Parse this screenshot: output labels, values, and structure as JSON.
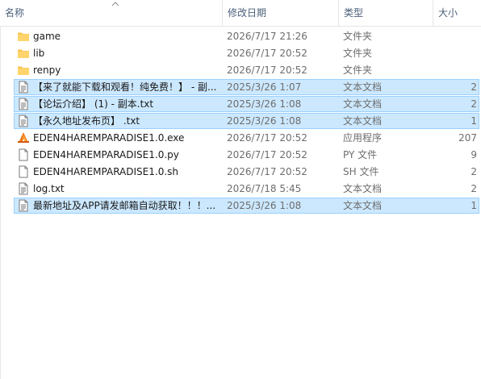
{
  "columns": {
    "name": "名称",
    "date": "修改日期",
    "type": "类型",
    "size": "大小"
  },
  "rows": [
    {
      "name": "game",
      "date": "2026/7/17 21:26",
      "type": "文件夹",
      "size": "",
      "icon": "folder-icon",
      "selected": false
    },
    {
      "name": "lib",
      "date": "2026/7/17 20:52",
      "type": "文件夹",
      "size": "",
      "icon": "folder-icon",
      "selected": false
    },
    {
      "name": "renpy",
      "date": "2026/7/17 20:52",
      "type": "文件夹",
      "size": "",
      "icon": "folder-icon",
      "selected": false
    },
    {
      "name": "【来了就能下载和观看！纯免费！】 - 副...",
      "date": "2025/3/26 1:07",
      "type": "文本文档",
      "size": "2",
      "icon": "text-file-icon",
      "selected": true
    },
    {
      "name": "【论坛介绍】 (1) - 副本.txt",
      "date": "2025/3/26 1:08",
      "type": "文本文档",
      "size": "2",
      "icon": "text-file-icon",
      "selected": true
    },
    {
      "name": "【永久地址发布页】 .txt",
      "date": "2025/3/26 1:08",
      "type": "文本文档",
      "size": "1",
      "icon": "text-file-icon",
      "selected": true
    },
    {
      "name": "EDEN4HAREMPARADISE1.0.exe",
      "date": "2026/7/17 20:52",
      "type": "应用程序",
      "size": "207",
      "icon": "renpy-app-icon",
      "selected": false
    },
    {
      "name": "EDEN4HAREMPARADISE1.0.py",
      "date": "2026/7/17 20:52",
      "type": "PY 文件",
      "size": "9",
      "icon": "blank-file-icon",
      "selected": false
    },
    {
      "name": "EDEN4HAREMPARADISE1.0.sh",
      "date": "2026/7/17 20:52",
      "type": "SH 文件",
      "size": "2",
      "icon": "blank-file-icon",
      "selected": false
    },
    {
      "name": "log.txt",
      "date": "2026/7/18 5:45",
      "type": "文本文档",
      "size": "2",
      "icon": "text-file-icon",
      "selected": false
    },
    {
      "name": "最新地址及APP请发邮箱自动获取！！！...",
      "date": "2025/3/26 1:08",
      "type": "文本文档",
      "size": "1",
      "icon": "text-file-icon",
      "selected": true
    }
  ],
  "colors": {
    "folder": "#f8c44f",
    "selection_fill": "#cce8ff",
    "selection_border": "#99d1ff",
    "header_text": "#4c607a"
  }
}
